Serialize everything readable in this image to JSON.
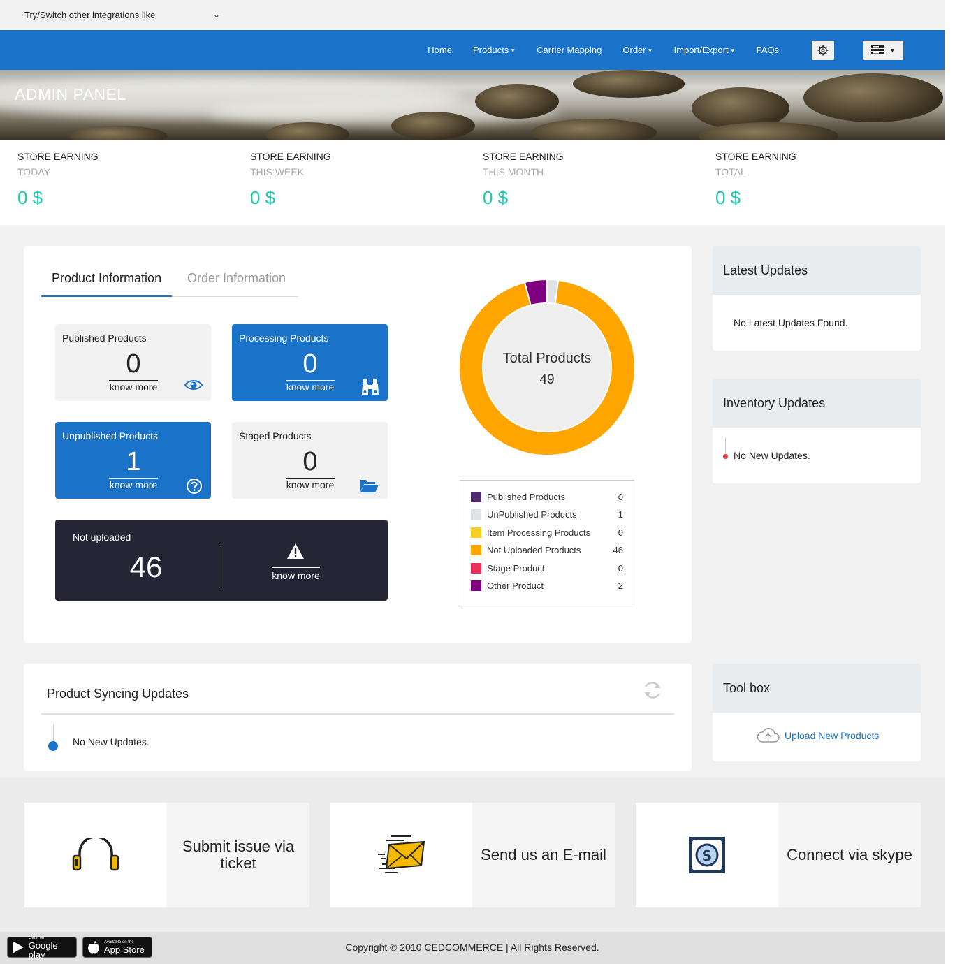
{
  "integration_select": {
    "label": "Try/Switch other integrations like"
  },
  "nav": {
    "items": [
      {
        "label": "Home",
        "dropdown": false
      },
      {
        "label": "Products",
        "dropdown": true
      },
      {
        "label": "Carrier Mapping",
        "dropdown": false
      },
      {
        "label": "Order",
        "dropdown": true
      },
      {
        "label": "Import/Export",
        "dropdown": true
      },
      {
        "label": "FAQs",
        "dropdown": false
      }
    ],
    "settings_icon": "gear-icon",
    "menu_icon": "menu-icon"
  },
  "banner": {
    "title": "ADMIN PANEL"
  },
  "earnings": [
    {
      "label": "STORE EARNING",
      "period": "TODAY",
      "value": "0 $"
    },
    {
      "label": "STORE EARNING",
      "period": "THIS WEEK",
      "value": "0 $"
    },
    {
      "label": "STORE EARNING",
      "period": "THIS MONTH",
      "value": "0 $"
    },
    {
      "label": "STORE EARNING",
      "period": "TOTAL",
      "value": "0 $"
    }
  ],
  "tabs": {
    "active": "Product Information",
    "inactive": "Order Information"
  },
  "tiles": {
    "published": {
      "title": "Published Products",
      "count": "0",
      "more": "know more",
      "icon": "eye-icon"
    },
    "processing": {
      "title": "Processing Products",
      "count": "0",
      "more": "know more",
      "icon": "binoculars-icon"
    },
    "unpublished": {
      "title": "Unpublished Products",
      "count": "1",
      "more": "know more",
      "icon": "question-icon"
    },
    "staged": {
      "title": "Staged Products",
      "count": "0",
      "more": "know more",
      "icon": "folder-open-icon"
    },
    "not_uploaded": {
      "title": "Not uploaded",
      "count": "46",
      "more": "know more",
      "icon": "warning-icon"
    }
  },
  "donut": {
    "label": "Total Products",
    "total": "49"
  },
  "chart_data": {
    "type": "pie",
    "title": "Total Products",
    "categories": [
      "Published Products",
      "UnPublished Products",
      "Item Processing Products",
      "Not Uploaded Products",
      "Stage Product",
      "Other Product"
    ],
    "values": [
      0,
      1,
      0,
      46,
      0,
      2
    ],
    "colors": [
      "#4b2e6b",
      "#e0e3e6",
      "#f5d020",
      "#ffa500",
      "#e8305a",
      "#800080"
    ],
    "legend": "bottom"
  },
  "legend": [
    {
      "name": "Published Products",
      "count": "0",
      "color": "#4b2e6b"
    },
    {
      "name": "UnPublished Products",
      "count": "1",
      "color": "#e0e3e6"
    },
    {
      "name": "Item Processing Products",
      "count": "0",
      "color": "#f5d020"
    },
    {
      "name": "Not Uploaded Products",
      "count": "46",
      "color": "#ffa500"
    },
    {
      "name": "Stage Product",
      "count": "0",
      "color": "#e8305a"
    },
    {
      "name": "Other Product",
      "count": "2",
      "color": "#800080"
    }
  ],
  "latest_updates": {
    "title": "Latest Updates",
    "message": "No Latest Updates Found."
  },
  "inventory_updates": {
    "title": "Inventory Updates",
    "message": "No New Updates."
  },
  "sync": {
    "title": "Product Syncing Updates",
    "message": "No New Updates."
  },
  "toolbox": {
    "title": "Tool box",
    "upload_label": "Upload New Products"
  },
  "support": [
    {
      "label": "Submit issue via ticket",
      "icon": "headphones-icon"
    },
    {
      "label": "Send us an E-mail",
      "icon": "email-icon"
    },
    {
      "label": "Connect via skype",
      "icon": "skype-icon"
    }
  ],
  "footer": {
    "google_small": "Get it on",
    "google_big": "Google play",
    "apple_small": "Available on the",
    "apple_big": "App Store",
    "copyright": "Copyright © 2010 CEDCOMMERCE | All Rights Reserved."
  },
  "colors": {
    "primary": "#1a73c8",
    "accent_teal": "#1ec9b0",
    "dark_tile": "#252535"
  }
}
